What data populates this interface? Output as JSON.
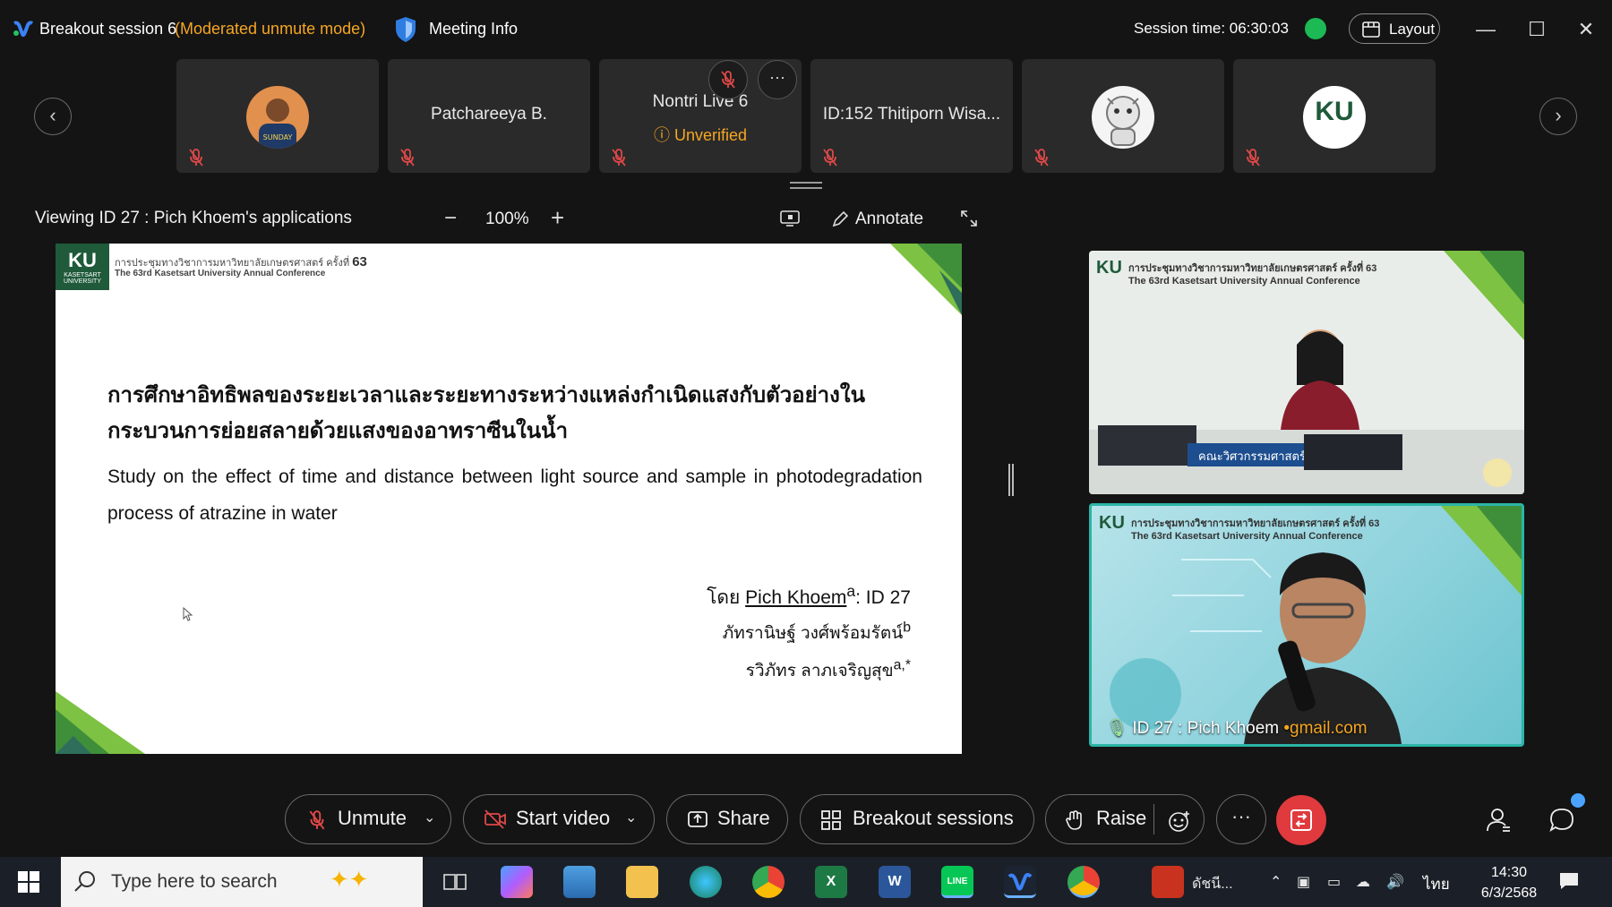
{
  "titlebar": {
    "session_name": "Breakout session 6",
    "mode": "(Moderated unmute mode)",
    "meeting_info": "Meeting Info",
    "session_time": "Session time: 06:30:03",
    "layout": "Layout",
    "minimize": "—",
    "maximize": "☐",
    "close": "✕"
  },
  "participants": [
    {
      "name": "",
      "has_avatar": true,
      "muted": true
    },
    {
      "name": "Patchareeya B.",
      "muted": true
    },
    {
      "name": "Nontri Live 6",
      "status": "Unverified",
      "muted": true
    },
    {
      "name": "ID:152 Thitiporn Wisa...",
      "muted": true
    },
    {
      "name": "",
      "has_avatar": true,
      "muted": true
    },
    {
      "name": "",
      "has_avatar": true,
      "avatar_text": "KU",
      "muted": true
    }
  ],
  "strip": {
    "prev": "‹",
    "next": "›",
    "more": "···"
  },
  "viewing": {
    "label": "Viewing ID 27 : Pich Khoem's applications",
    "zoom": "100%",
    "zoom_minus": "−",
    "zoom_plus": "+",
    "annotate": "Annotate"
  },
  "slide": {
    "logo": "KU",
    "logo_sub": "KASETSART UNIVERSITY",
    "header_th": "การประชุมทางวิชาการมหาวิทยาลัยเกษตรศาสตร์ ครั้งที่",
    "header_num": "63",
    "header_en": "The 63rd Kasetsart University Annual Conference",
    "title_th": "การศึกษาอิทธิพลของระยะเวลาและระยะทางระหว่างแหล่งกำเนิดแสงกับตัวอย่างในกระบวนการย่อยสลายด้วยแสงของอาทราซีนในน้ำ",
    "title_en": "Study on the effect of time and distance between light source and sample in photodegradation process of atrazine in water",
    "by_prefix": "โดย",
    "presenter": "Pich Khoem",
    "presenter_sup": "a",
    "presenter_id": ": ID 27",
    "author2": "ภัทรานิษฐ์ วงศ์พร้อมรัตน์",
    "author2_sup": "b",
    "author3": "รวิภัทร ลาภเจริญสุข",
    "author3_sup": "a,*"
  },
  "videos": {
    "top_logo": "KU",
    "top_header": "การประชุมทางวิชาการมหาวิทยาลัยเกษตรศาสตร์ ครั้งที่ 63 The 63rd Kasetsart University Annual Conference",
    "top_banner": "คณะวิศวกรรมศาสตร์",
    "bottom_logo": "KU",
    "bottom_header": "การประชุมทางวิชาการมหาวิทยาลัยเกษตรศาสตร์ ครั้งที่ 63 The 63rd Kasetsart University Annual Conference",
    "presenter_name": "ID 27 : Pich Khoem",
    "presenter_email": "•gmail.com"
  },
  "controls": {
    "unmute": "Unmute",
    "start_video": "Start video",
    "share": "Share",
    "breakout": "Breakout sessions",
    "raise": "Raise",
    "more": "···"
  },
  "taskbar": {
    "search_placeholder": "Type here to search",
    "app_label": "ดัชนี...",
    "lang": "ไทย",
    "time": "14:30",
    "date": "6/3/2568"
  },
  "colors": {
    "accent_orange": "#f5a623",
    "leave_red": "#e03a3e",
    "ku_green": "#1f5a3a",
    "active_border": "#2bb5a6"
  }
}
